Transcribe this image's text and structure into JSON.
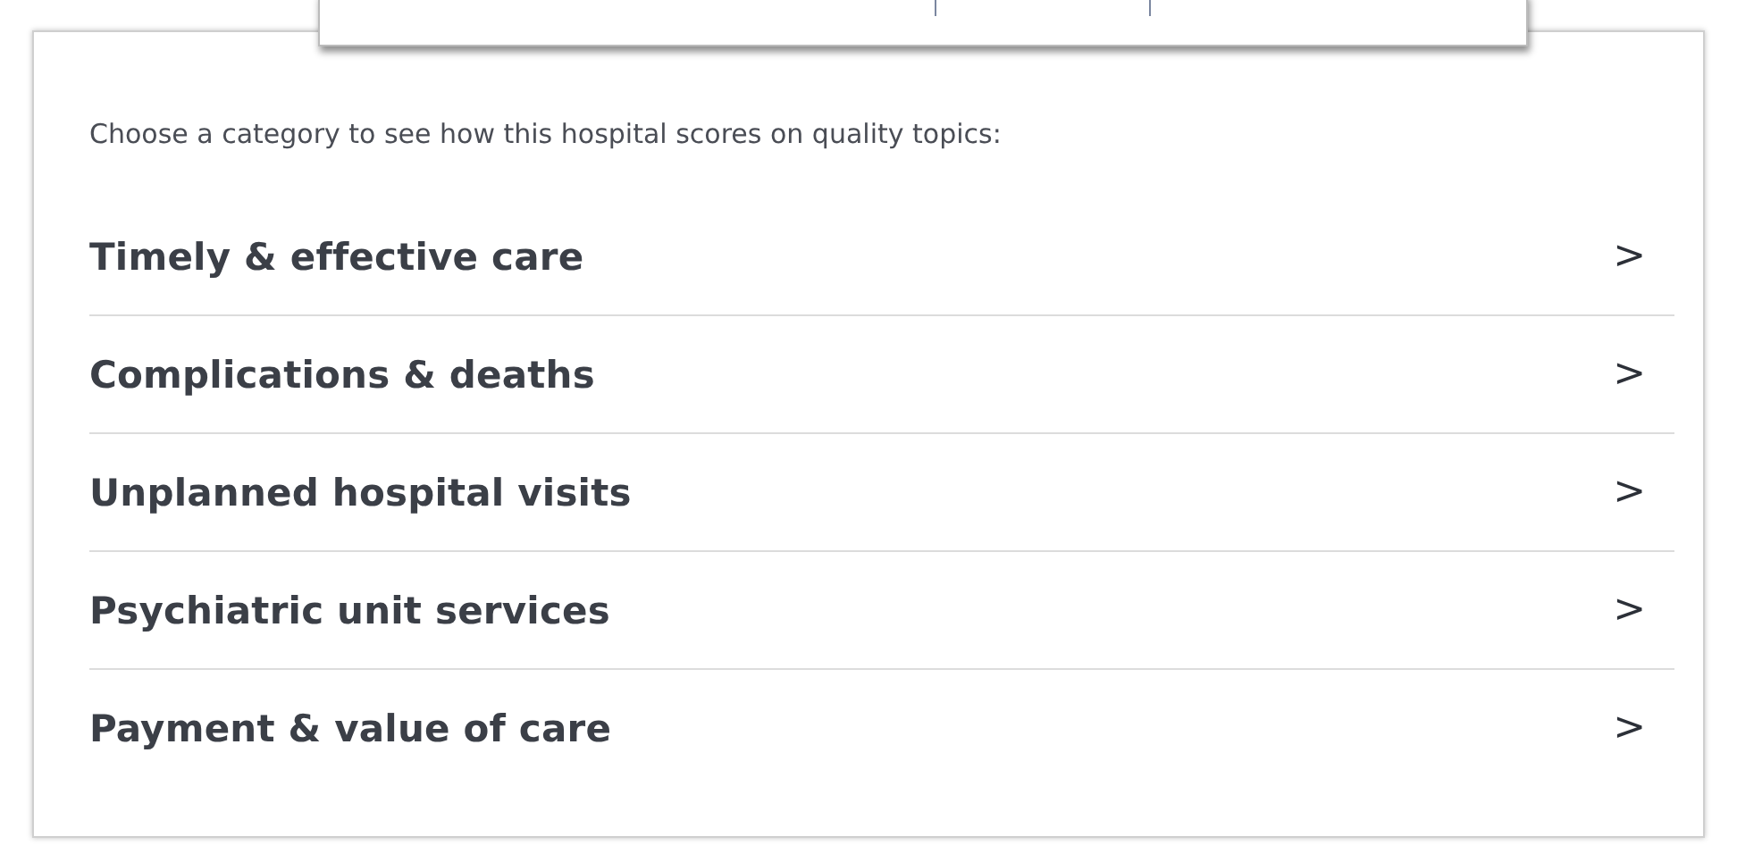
{
  "intro": "Choose a category to see how this hospital scores on quality topics:",
  "categories": [
    {
      "label": "Timely & effective care",
      "icon": ">"
    },
    {
      "label": "Complications & deaths",
      "icon": ">"
    },
    {
      "label": "Unplanned hospital visits",
      "icon": ">"
    },
    {
      "label": "Psychiatric unit services",
      "icon": ">"
    },
    {
      "label": "Payment & value of care",
      "icon": ">"
    }
  ]
}
